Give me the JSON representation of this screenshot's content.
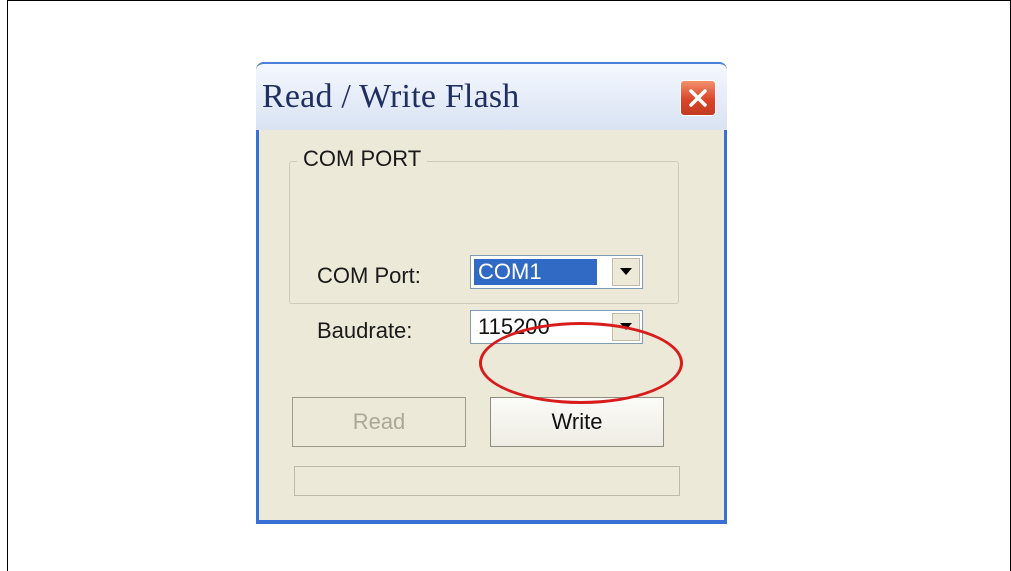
{
  "window": {
    "title": "Read / Write Flash",
    "close_icon": "close-icon"
  },
  "com_group": {
    "title": "COM PORT",
    "com_port": {
      "label": "COM Port:",
      "value": "COM1"
    },
    "baudrate": {
      "label": "Baudrate:",
      "value": "115200"
    }
  },
  "buttons": {
    "read": "Read",
    "write": "Write"
  },
  "progress": {
    "value": 0
  },
  "colors": {
    "titlebar_blue": "#3a6fd6",
    "close_red": "#d9462a",
    "highlight_red": "#d81c1c",
    "selection": "#316ac5"
  }
}
